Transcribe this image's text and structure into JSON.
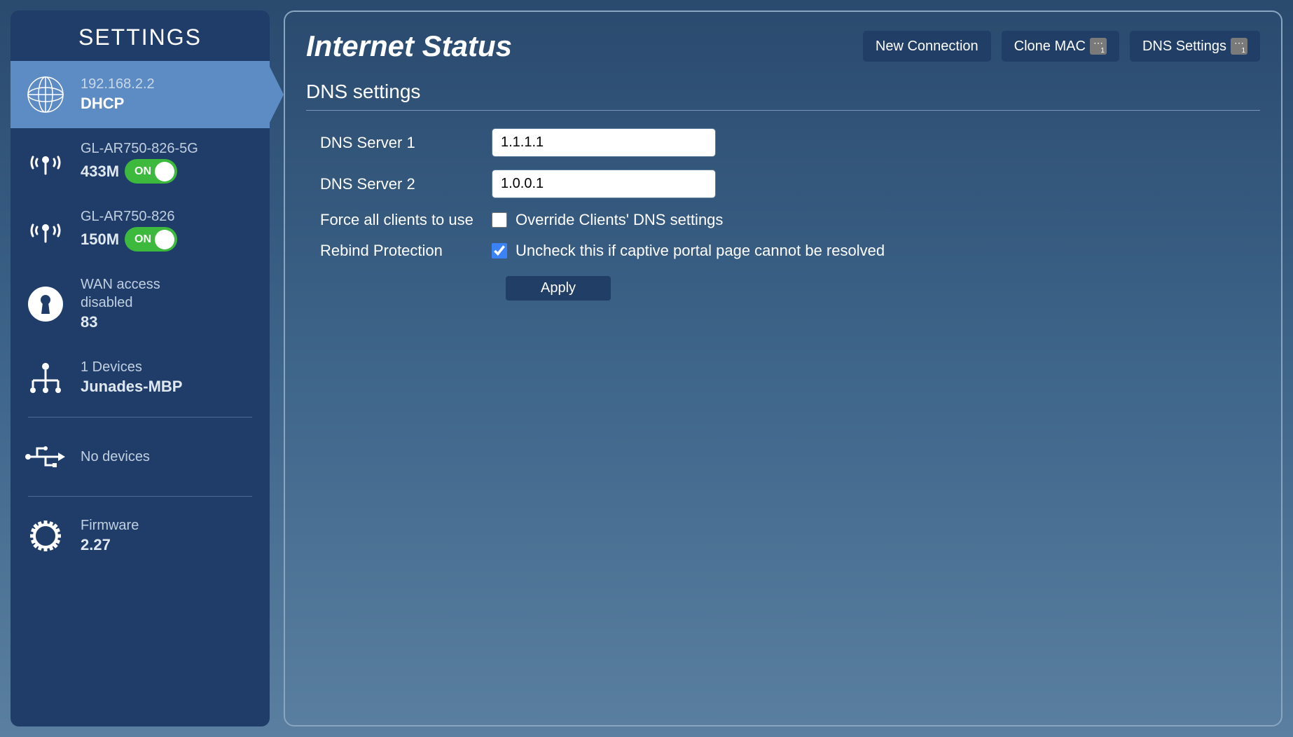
{
  "sidebar": {
    "title": "SETTINGS",
    "items": [
      {
        "line1": "192.168.2.2",
        "line2": "DHCP"
      },
      {
        "line1": "GL-AR750-826-5G",
        "line2": "433M",
        "toggle": "ON"
      },
      {
        "line1": "GL-AR750-826",
        "line2": "150M",
        "toggle": "ON"
      },
      {
        "line1": "WAN access",
        "line2": "disabled",
        "line3": "83"
      },
      {
        "line1": "1 Devices",
        "line2": "Junades-MBP"
      },
      {
        "line1": "No devices"
      },
      {
        "line1": "Firmware",
        "line2": "2.27"
      }
    ]
  },
  "main": {
    "title": "Internet Status",
    "buttons": {
      "new_connection": "New Connection",
      "clone_mac": "Clone MAC",
      "dns_settings": "DNS Settings"
    },
    "section_title": "DNS settings",
    "form": {
      "dns1_label": "DNS Server 1",
      "dns1_value": "1.1.1.1",
      "dns2_label": "DNS Server 2",
      "dns2_value": "1.0.0.1",
      "force_label": "Force all clients to use",
      "force_text": "Override Clients' DNS settings",
      "force_checked": false,
      "rebind_label": "Rebind Protection",
      "rebind_text": "Uncheck this if captive portal page cannot be resolved",
      "rebind_checked": true,
      "apply": "Apply"
    }
  }
}
